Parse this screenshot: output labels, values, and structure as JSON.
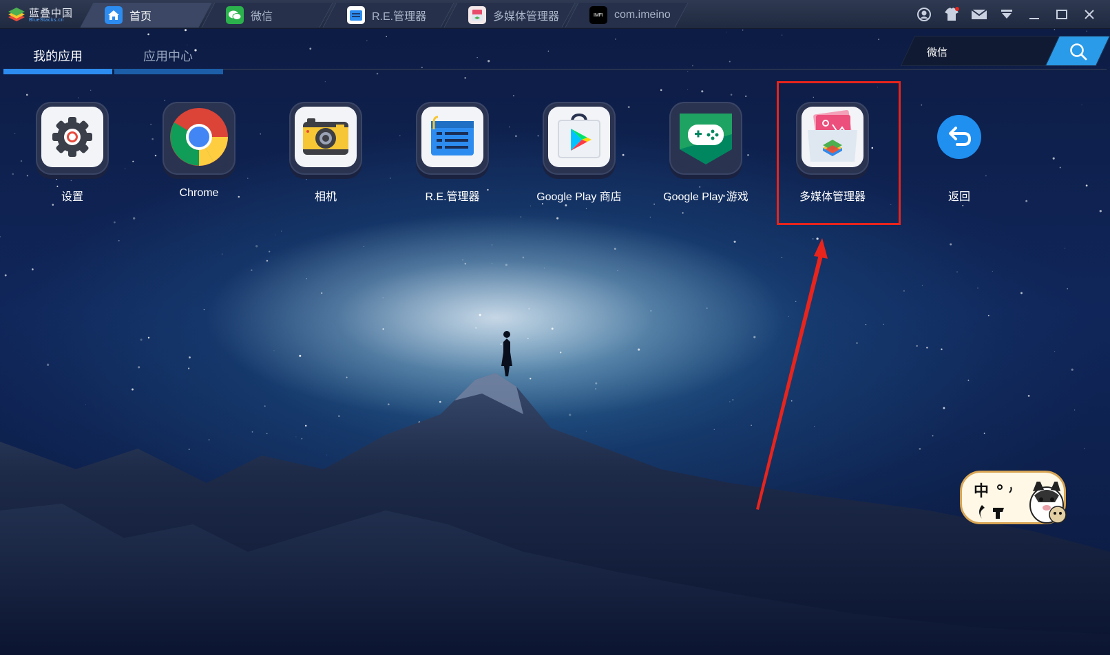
{
  "titlebar": {
    "brand": "蓝叠中国",
    "brand_sub": "BlueStacks.cn",
    "tabs": [
      {
        "label": "首页",
        "icon": "home-icon",
        "active": true
      },
      {
        "label": "微信",
        "icon": "wechat-icon",
        "active": false
      },
      {
        "label": "R.E.管理器",
        "icon": "re-manager-icon",
        "active": false
      },
      {
        "label": "多媒体管理器",
        "icon": "media-manager-icon",
        "active": false
      },
      {
        "label": "com.imeino",
        "icon": "imeino-icon",
        "active": false
      }
    ],
    "tab4_icon_text": "IMFI",
    "controls": [
      "user-icon",
      "shirt-icon",
      "mail-icon",
      "dropdown-icon",
      "minimize-icon",
      "maximize-icon",
      "close-icon"
    ]
  },
  "nav": {
    "tabs": [
      {
        "label": "我的应用",
        "active": true
      },
      {
        "label": "应用中心",
        "active": false
      }
    ]
  },
  "search": {
    "value": "微信",
    "placeholder": ""
  },
  "apps": [
    {
      "label": "设置",
      "icon": "settings-gear-icon"
    },
    {
      "label": "Chrome",
      "icon": "chrome-icon"
    },
    {
      "label": "相机",
      "icon": "camera-icon"
    },
    {
      "label": "R.E.管理器",
      "icon": "re-manager-icon"
    },
    {
      "label": "Google Play 商店",
      "icon": "google-play-store-icon"
    },
    {
      "label": "Google Play 游戏",
      "icon": "google-play-games-icon"
    },
    {
      "label": "多媒体管理器",
      "icon": "media-manager-icon"
    },
    {
      "label": "返回",
      "icon": "back-arrow-icon"
    }
  ],
  "highlighted_app": "多媒体管理器",
  "ime_widget": {
    "text": "中",
    "icon": "ime-mascot-icon"
  },
  "colors": {
    "accent": "#2d8cf0",
    "highlight": "#e8241c",
    "titlebar": "#2a344c"
  }
}
